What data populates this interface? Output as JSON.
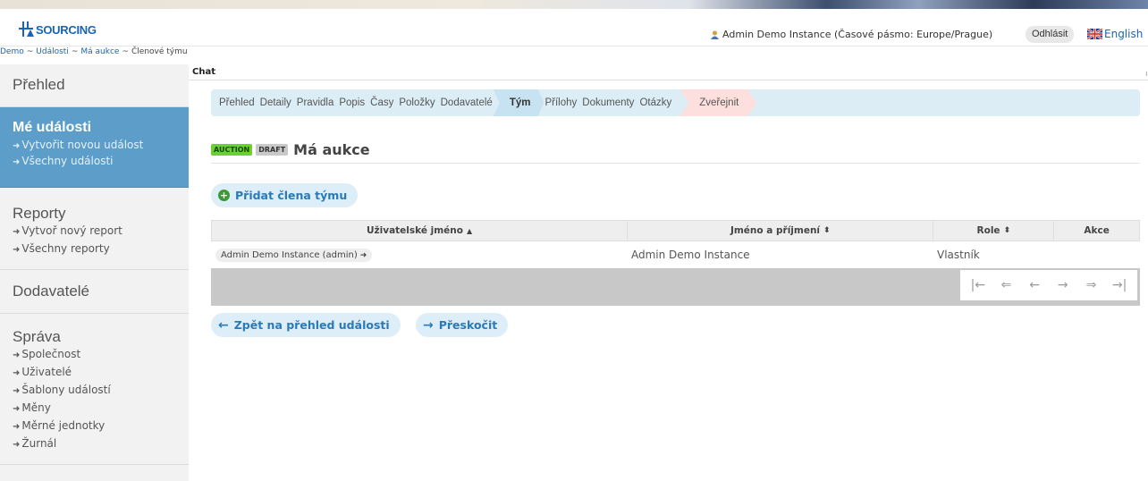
{
  "header": {
    "logo_text": "SOURCING",
    "user_info": "Admin Demo Instance (Časové pásmo: Europe/Prague)",
    "logout_label": "Odhlásit",
    "language_label": "English"
  },
  "breadcrumb": {
    "items": [
      "Demo",
      "Události",
      "Má aukce"
    ],
    "separator": "~",
    "current": "Členové týmu"
  },
  "sidebar": {
    "overview": "Přehled",
    "my_events": {
      "title": "Mé události",
      "links": [
        "Vytvořit novou událost",
        "Všechny události"
      ]
    },
    "reports": {
      "title": "Reporty",
      "links": [
        "Vytvoř nový report",
        "Všechny reporty"
      ]
    },
    "suppliers": "Dodavatelé",
    "admin": {
      "title": "Správa",
      "links": [
        "Společnost",
        "Uživatelé",
        "Šablony událostí",
        "Měny",
        "Měrné jednotky",
        "Žurnál"
      ]
    }
  },
  "chat_label": "Chat",
  "steps": {
    "before": [
      "Přehled",
      "Detaily",
      "Pravidla",
      "Popis",
      "Časy",
      "Položky",
      "Dodavatelé"
    ],
    "active": "Tým",
    "after": [
      "Přílohy",
      "Dokumenty",
      "Otázky"
    ],
    "publish": "Zveřejnit"
  },
  "event": {
    "badge_type": "AUCTION",
    "badge_status": "DRAFT",
    "title": "Má aukce"
  },
  "add_member_label": "Přidat člena týmu",
  "table": {
    "columns": [
      {
        "label": "Uživatelské jméno",
        "sort": "▲"
      },
      {
        "label": "Jméno a příjmení",
        "sort": "⬍"
      },
      {
        "label": "Role",
        "sort": "⬍"
      },
      {
        "label": "Akce",
        "sort": ""
      }
    ],
    "rows": [
      {
        "username": "Admin Demo Instance (admin)",
        "full_name": "Admin Demo Instance",
        "role": "Vlastník",
        "action": ""
      }
    ]
  },
  "pager_icons": [
    "first-page-icon",
    "fast-back-icon",
    "prev-page-icon",
    "next-page-icon",
    "fast-forward-icon",
    "last-page-icon"
  ],
  "back_label": "Zpět na přehled události",
  "skip_label": "Přeskočit",
  "colors": {
    "sidebar_active": "#5c9ec9",
    "steps_bg": "#dcedf6",
    "link_blue": "#1a64b5",
    "auction_badge": "#6ecf31",
    "publish_step": "#fde0dd"
  }
}
